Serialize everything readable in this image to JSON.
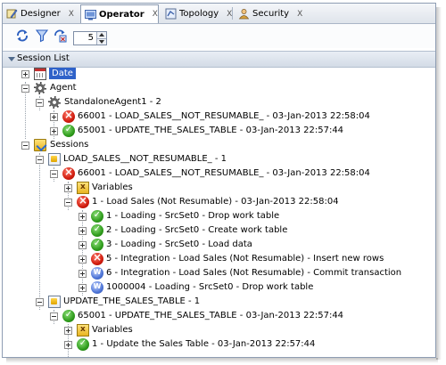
{
  "tabs": [
    {
      "label": "Designer",
      "close": "X",
      "icon": "designer-icon"
    },
    {
      "label": "Operator",
      "close": "X",
      "icon": "operator-icon",
      "active": true
    },
    {
      "label": "Topology",
      "close": "X",
      "icon": "topology-icon"
    },
    {
      "label": "Security",
      "close": "X",
      "icon": "security-icon"
    }
  ],
  "toolbar": {
    "refresh_icon": "refresh-icon",
    "filter_icon": "filter-icon",
    "purge_icon": "purge-log-icon",
    "limit_value": "5"
  },
  "panel": {
    "title": "Session List"
  },
  "tree": [
    {
      "text": "Date",
      "icon": "calendar-icon",
      "status": "date",
      "selected": true
    },
    {
      "text": "Agent",
      "icon": "agent-icon",
      "status": "gear"
    },
    {
      "text": "StandaloneAgent1 - 2",
      "icon": "agent-icon",
      "status": "gear"
    },
    {
      "text": "66001 - LOAD_SALES__NOT_RESUMABLE_ - 03-Jan-2013 22:58:04",
      "icon": "error-icon",
      "status": "error"
    },
    {
      "text": "65001 - UPDATE_THE_SALES_TABLE - 03-Jan-2013 22:57:44",
      "icon": "success-icon",
      "status": "done"
    },
    {
      "text": "Sessions",
      "icon": "sessions-folder-icon",
      "status": "sessions"
    },
    {
      "text": "LOAD_SALES__NOT_RESUMABLE_ - 1",
      "icon": "session-icon",
      "status": "session"
    },
    {
      "text": "66001 - LOAD_SALES__NOT_RESUMABLE_ - 03-Jan-2013 22:58:04",
      "icon": "error-icon",
      "status": "error"
    },
    {
      "text": "Variables",
      "icon": "variables-icon",
      "status": "vars"
    },
    {
      "text": "1 - Load Sales (Not Resumable) - 03-Jan-2013 22:58:04",
      "icon": "error-icon",
      "status": "error"
    },
    {
      "text": "1 - Loading - SrcSet0 - Drop work table",
      "icon": "success-icon",
      "status": "done"
    },
    {
      "text": "2 - Loading - SrcSet0 - Create work table",
      "icon": "success-icon",
      "status": "done"
    },
    {
      "text": "3 - Loading - SrcSet0 - Load data",
      "icon": "success-icon",
      "status": "done"
    },
    {
      "text": "5 - Integration - Load Sales (Not Resumable) - Insert new rows",
      "icon": "error-icon",
      "status": "error"
    },
    {
      "text": "6 - Integration - Load Sales (Not Resumable) - Commit transaction",
      "icon": "waiting-icon",
      "status": "waiting"
    },
    {
      "text": "1000004 - Loading - SrcSet0 - Drop work table",
      "icon": "waiting-icon",
      "status": "waiting"
    },
    {
      "text": "UPDATE_THE_SALES_TABLE - 1",
      "icon": "session-icon",
      "status": "session"
    },
    {
      "text": "65001 - UPDATE_THE_SALES_TABLE - 03-Jan-2013 22:57:44",
      "icon": "success-icon",
      "status": "done"
    },
    {
      "text": "Variables",
      "icon": "variables-icon",
      "status": "vars"
    },
    {
      "text": "1 - Update the Sales Table - 03-Jan-2013 22:57:44",
      "icon": "success-icon",
      "status": "done"
    }
  ],
  "colors": {
    "selection": "#2f62c9",
    "error": "#d11d0f",
    "success": "#2f9c1c",
    "waiting": "#4d74d6"
  }
}
